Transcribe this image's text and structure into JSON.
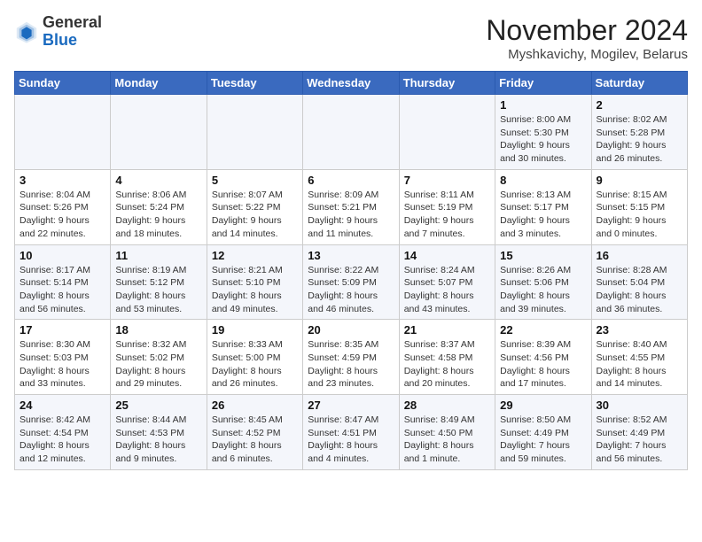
{
  "header": {
    "logo_general": "General",
    "logo_blue": "Blue",
    "month_title": "November 2024",
    "subtitle": "Myshkavichy, Mogilev, Belarus"
  },
  "weekdays": [
    "Sunday",
    "Monday",
    "Tuesday",
    "Wednesday",
    "Thursday",
    "Friday",
    "Saturday"
  ],
  "weeks": [
    [
      {
        "day": "",
        "info": ""
      },
      {
        "day": "",
        "info": ""
      },
      {
        "day": "",
        "info": ""
      },
      {
        "day": "",
        "info": ""
      },
      {
        "day": "",
        "info": ""
      },
      {
        "day": "1",
        "info": "Sunrise: 8:00 AM\nSunset: 5:30 PM\nDaylight: 9 hours and 30 minutes."
      },
      {
        "day": "2",
        "info": "Sunrise: 8:02 AM\nSunset: 5:28 PM\nDaylight: 9 hours and 26 minutes."
      }
    ],
    [
      {
        "day": "3",
        "info": "Sunrise: 8:04 AM\nSunset: 5:26 PM\nDaylight: 9 hours and 22 minutes."
      },
      {
        "day": "4",
        "info": "Sunrise: 8:06 AM\nSunset: 5:24 PM\nDaylight: 9 hours and 18 minutes."
      },
      {
        "day": "5",
        "info": "Sunrise: 8:07 AM\nSunset: 5:22 PM\nDaylight: 9 hours and 14 minutes."
      },
      {
        "day": "6",
        "info": "Sunrise: 8:09 AM\nSunset: 5:21 PM\nDaylight: 9 hours and 11 minutes."
      },
      {
        "day": "7",
        "info": "Sunrise: 8:11 AM\nSunset: 5:19 PM\nDaylight: 9 hours and 7 minutes."
      },
      {
        "day": "8",
        "info": "Sunrise: 8:13 AM\nSunset: 5:17 PM\nDaylight: 9 hours and 3 minutes."
      },
      {
        "day": "9",
        "info": "Sunrise: 8:15 AM\nSunset: 5:15 PM\nDaylight: 9 hours and 0 minutes."
      }
    ],
    [
      {
        "day": "10",
        "info": "Sunrise: 8:17 AM\nSunset: 5:14 PM\nDaylight: 8 hours and 56 minutes."
      },
      {
        "day": "11",
        "info": "Sunrise: 8:19 AM\nSunset: 5:12 PM\nDaylight: 8 hours and 53 minutes."
      },
      {
        "day": "12",
        "info": "Sunrise: 8:21 AM\nSunset: 5:10 PM\nDaylight: 8 hours and 49 minutes."
      },
      {
        "day": "13",
        "info": "Sunrise: 8:22 AM\nSunset: 5:09 PM\nDaylight: 8 hours and 46 minutes."
      },
      {
        "day": "14",
        "info": "Sunrise: 8:24 AM\nSunset: 5:07 PM\nDaylight: 8 hours and 43 minutes."
      },
      {
        "day": "15",
        "info": "Sunrise: 8:26 AM\nSunset: 5:06 PM\nDaylight: 8 hours and 39 minutes."
      },
      {
        "day": "16",
        "info": "Sunrise: 8:28 AM\nSunset: 5:04 PM\nDaylight: 8 hours and 36 minutes."
      }
    ],
    [
      {
        "day": "17",
        "info": "Sunrise: 8:30 AM\nSunset: 5:03 PM\nDaylight: 8 hours and 33 minutes."
      },
      {
        "day": "18",
        "info": "Sunrise: 8:32 AM\nSunset: 5:02 PM\nDaylight: 8 hours and 29 minutes."
      },
      {
        "day": "19",
        "info": "Sunrise: 8:33 AM\nSunset: 5:00 PM\nDaylight: 8 hours and 26 minutes."
      },
      {
        "day": "20",
        "info": "Sunrise: 8:35 AM\nSunset: 4:59 PM\nDaylight: 8 hours and 23 minutes."
      },
      {
        "day": "21",
        "info": "Sunrise: 8:37 AM\nSunset: 4:58 PM\nDaylight: 8 hours and 20 minutes."
      },
      {
        "day": "22",
        "info": "Sunrise: 8:39 AM\nSunset: 4:56 PM\nDaylight: 8 hours and 17 minutes."
      },
      {
        "day": "23",
        "info": "Sunrise: 8:40 AM\nSunset: 4:55 PM\nDaylight: 8 hours and 14 minutes."
      }
    ],
    [
      {
        "day": "24",
        "info": "Sunrise: 8:42 AM\nSunset: 4:54 PM\nDaylight: 8 hours and 12 minutes."
      },
      {
        "day": "25",
        "info": "Sunrise: 8:44 AM\nSunset: 4:53 PM\nDaylight: 8 hours and 9 minutes."
      },
      {
        "day": "26",
        "info": "Sunrise: 8:45 AM\nSunset: 4:52 PM\nDaylight: 8 hours and 6 minutes."
      },
      {
        "day": "27",
        "info": "Sunrise: 8:47 AM\nSunset: 4:51 PM\nDaylight: 8 hours and 4 minutes."
      },
      {
        "day": "28",
        "info": "Sunrise: 8:49 AM\nSunset: 4:50 PM\nDaylight: 8 hours and 1 minute."
      },
      {
        "day": "29",
        "info": "Sunrise: 8:50 AM\nSunset: 4:49 PM\nDaylight: 7 hours and 59 minutes."
      },
      {
        "day": "30",
        "info": "Sunrise: 8:52 AM\nSunset: 4:49 PM\nDaylight: 7 hours and 56 minutes."
      }
    ]
  ]
}
